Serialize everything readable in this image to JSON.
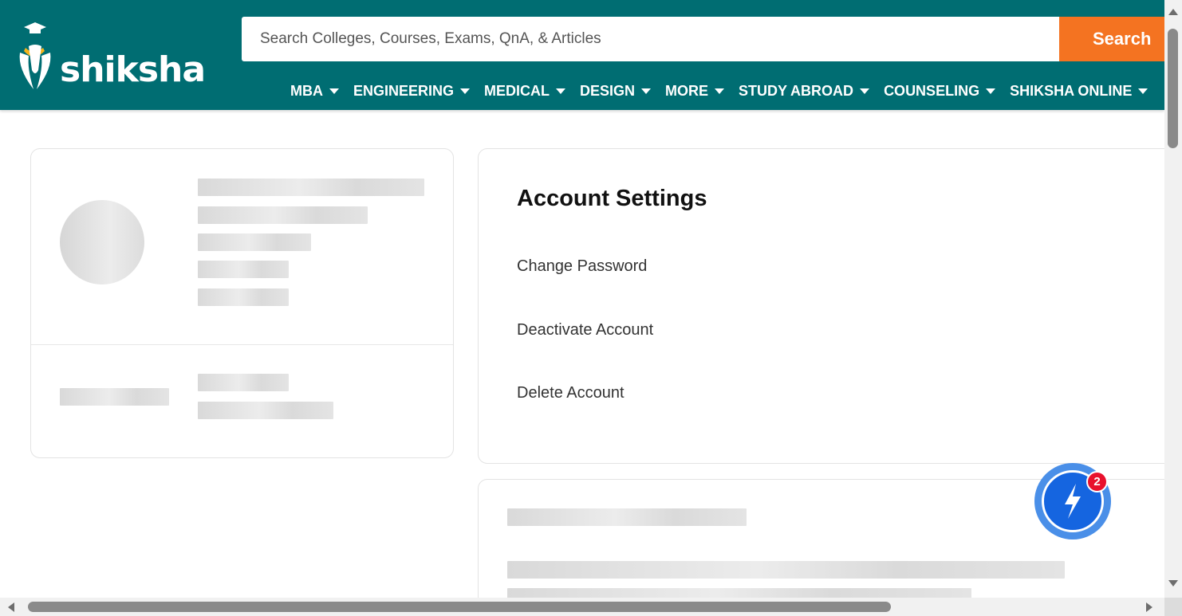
{
  "brand": {
    "name": "shiksha",
    "accent": "#006d72",
    "search_color": "#f47321"
  },
  "search": {
    "placeholder": "Search Colleges, Courses, Exams, QnA, & Articles",
    "button_label": "Search"
  },
  "nav": {
    "items": [
      {
        "label": "MBA"
      },
      {
        "label": "ENGINEERING"
      },
      {
        "label": "MEDICAL"
      },
      {
        "label": "DESIGN"
      },
      {
        "label": "MORE"
      },
      {
        "label": "STUDY ABROAD"
      },
      {
        "label": "COUNSELING"
      },
      {
        "label": "SHIKSHA ONLINE"
      }
    ]
  },
  "settings": {
    "title": "Account Settings",
    "links": [
      {
        "label": "Change Password"
      },
      {
        "label": "Deactivate Account"
      },
      {
        "label": "Delete Account"
      }
    ]
  },
  "chat": {
    "badge_count": "2",
    "icon": "lightning-chat-icon"
  }
}
